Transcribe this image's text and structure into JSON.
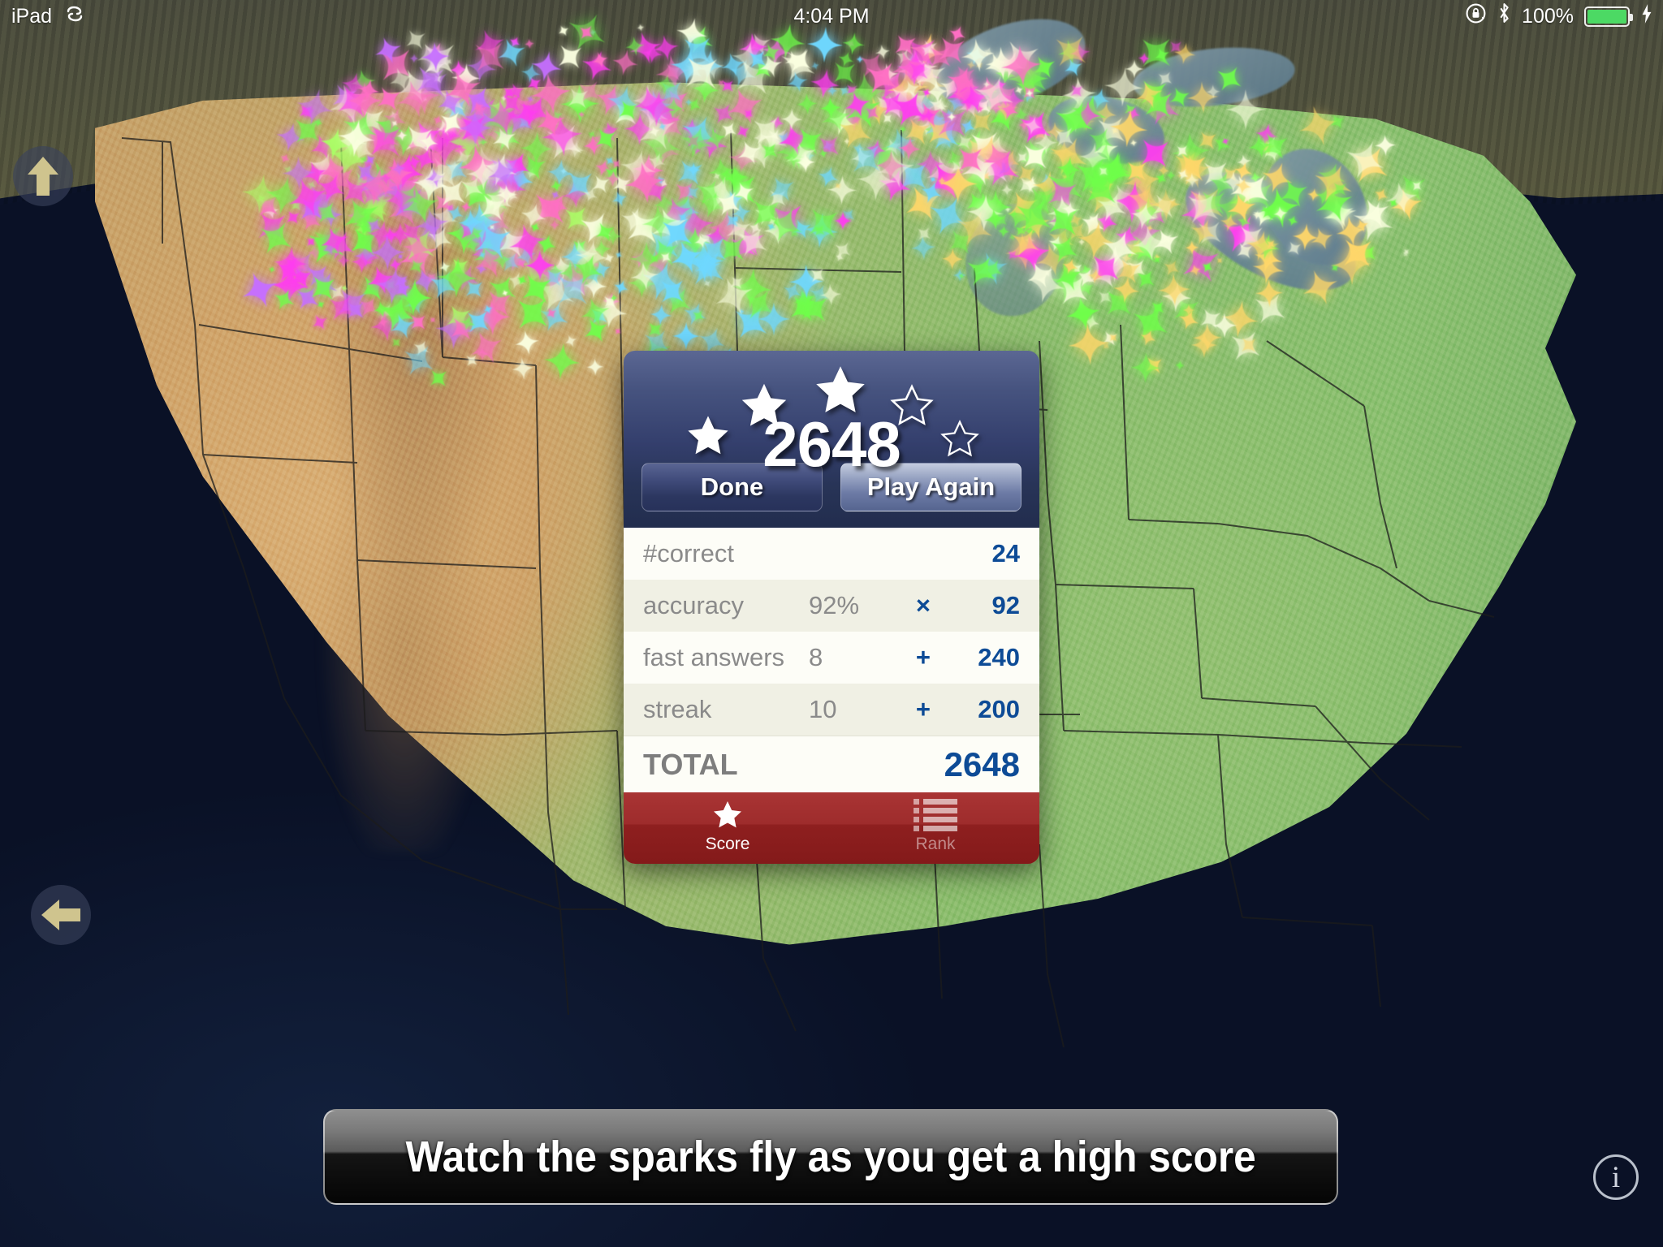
{
  "status_bar": {
    "device_label": "iPad",
    "sync_icon": "rotation-sync-icon",
    "time": "4:04 PM",
    "rotation_lock_icon": "rotation-lock-icon",
    "bluetooth_icon": "bluetooth-icon",
    "battery_percent": "100%",
    "battery_icon": "battery-full-icon",
    "charging_icon": "lightning-bolt-icon",
    "battery_color": "#4cd964"
  },
  "nav": {
    "up_button": "up-arrow",
    "back_button": "left-arrow",
    "info_button": "i"
  },
  "score_panel": {
    "score": "2648",
    "stars_total": 5,
    "stars_earned": 3,
    "star_states": [
      "filled",
      "filled",
      "filled",
      "outline",
      "outline"
    ],
    "buttons": {
      "done": "Done",
      "play_again": "Play Again"
    },
    "stats": [
      {
        "label": "#correct",
        "mid": "",
        "op": "",
        "value": "24"
      },
      {
        "label": "accuracy",
        "mid": "92%",
        "op": "×",
        "value": "92"
      },
      {
        "label": "fast answers",
        "mid": "8",
        "op": "+",
        "value": "240"
      },
      {
        "label": "streak",
        "mid": "10",
        "op": "+",
        "value": "200"
      }
    ],
    "total": {
      "label": "TOTAL",
      "value": "2648"
    },
    "tabs": [
      {
        "label": "Score",
        "icon": "star-icon",
        "active": true
      },
      {
        "label": "Rank",
        "icon": "list-icon",
        "active": false
      }
    ],
    "colors": {
      "header_blue": "#343f6d",
      "value_blue": "#0d4b96",
      "tabbar_red": "#8e1f1f"
    }
  },
  "caption": {
    "text": "Watch the sparks fly as you get a high score"
  },
  "background": {
    "scene": "relief-map-of-united-states",
    "sparkle_colors": [
      "#ff3df0",
      "#ff6fc4",
      "#6fff4a",
      "#6fd8ff",
      "#ffd76a",
      "#fbffe0",
      "#c66fff",
      "#aaff66"
    ]
  }
}
